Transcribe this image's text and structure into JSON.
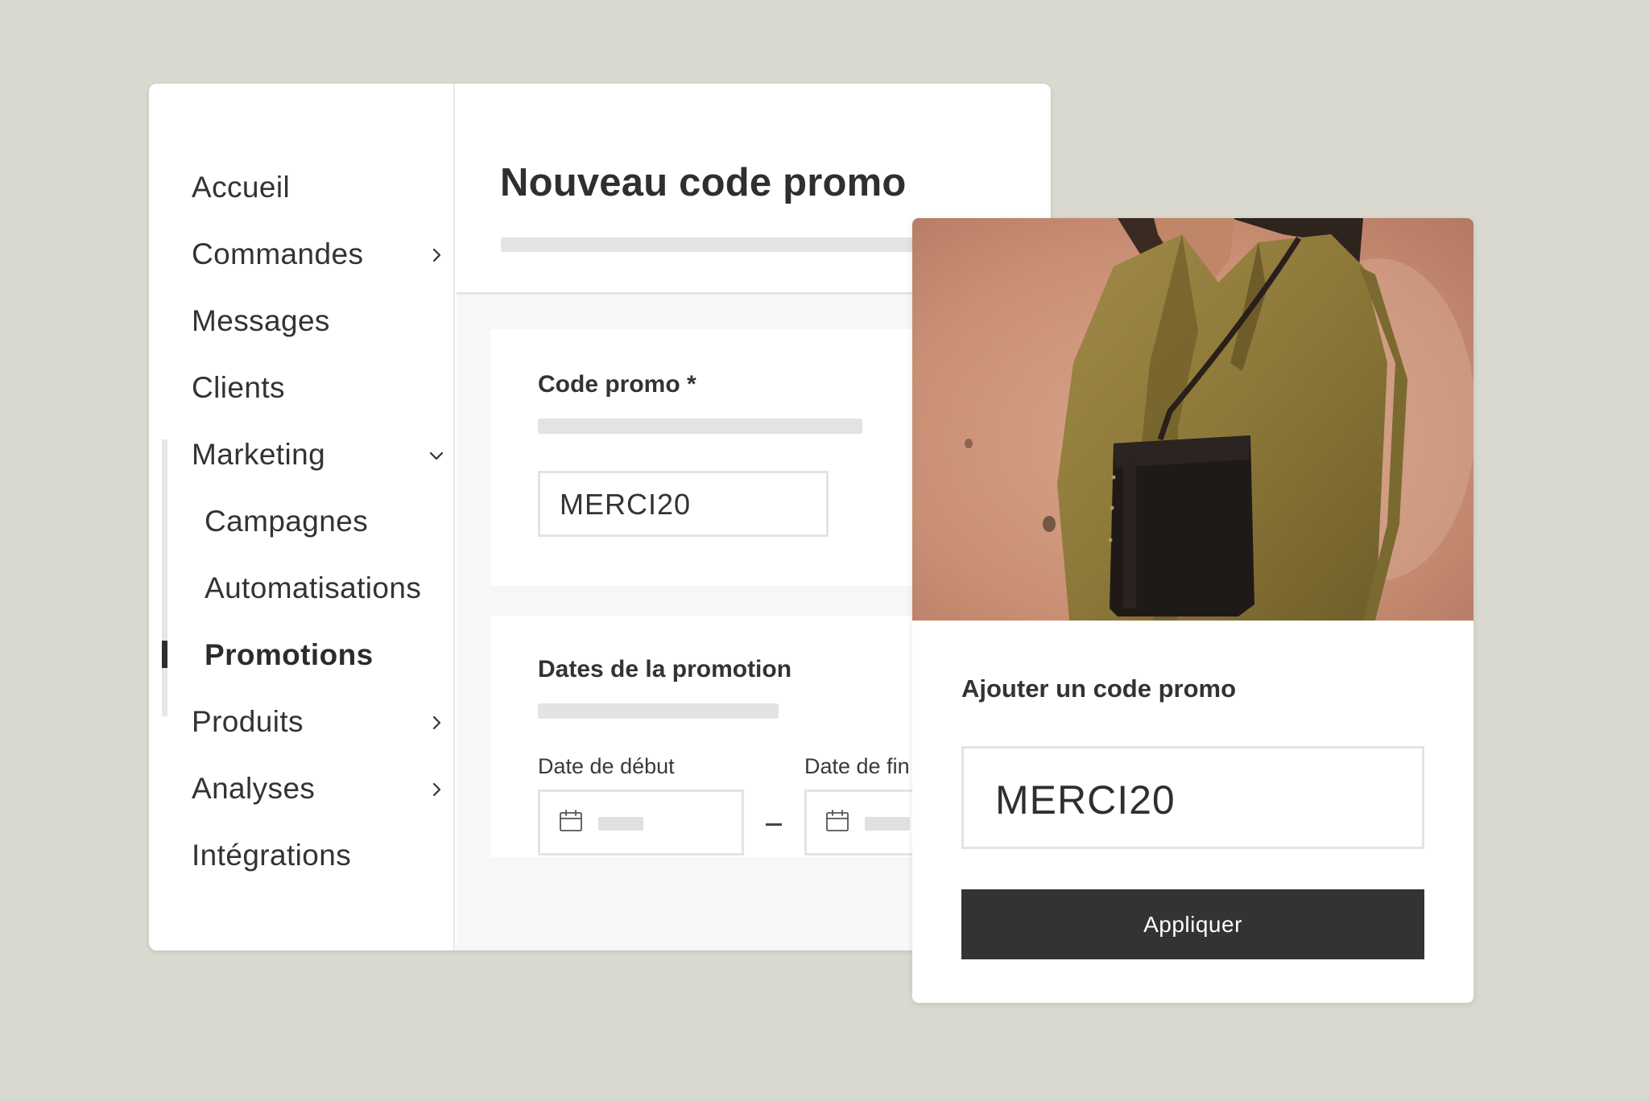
{
  "sidebar": {
    "items": [
      {
        "label": "Accueil"
      },
      {
        "label": "Commandes",
        "icon": "chevron-right-icon"
      },
      {
        "label": "Messages"
      },
      {
        "label": "Clients"
      },
      {
        "label": "Marketing",
        "icon": "chevron-down-icon",
        "expanded": true
      },
      {
        "label": "Campagnes"
      },
      {
        "label": "Automatisations"
      },
      {
        "label": "Promotions",
        "active": true
      },
      {
        "label": "Produits",
        "icon": "chevron-right-icon"
      },
      {
        "label": "Analyses",
        "icon": "chevron-right-icon"
      },
      {
        "label": "Intégrations"
      }
    ]
  },
  "main": {
    "title": "Nouveau code promo",
    "code_card": {
      "title": "Code promo *",
      "value": "MERCI20"
    },
    "dates_card": {
      "title": "Dates de la promotion",
      "start_label": "Date de début",
      "end_label": "Date de fin",
      "start_icon": "calendar-icon",
      "end_icon": "calendar-icon"
    }
  },
  "promo_popup": {
    "title": "Ajouter un code promo",
    "value": "MERCI20",
    "button": "Appliquer"
  },
  "colors": {
    "background": "#d9d9cf",
    "text": "#333333",
    "button": "#333333",
    "active_indicator": "#2e2e2e"
  }
}
